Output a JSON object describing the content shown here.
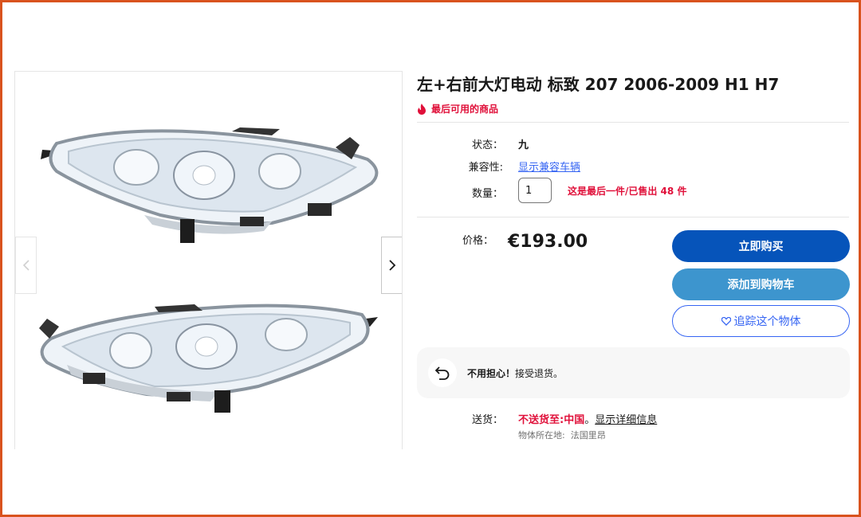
{
  "listing": {
    "title": "左+右前大灯电动 标致 207 2006-2009 H1 H7",
    "last_item_badge": "最后可用的商品"
  },
  "details": {
    "condition_label": "状态：",
    "condition_value": "九",
    "compat_label": "兼容性:",
    "compat_link": "显示兼容车辆",
    "quantity_label": "数量：",
    "quantity_value": "1",
    "quantity_note": "这是最后一件/已售出 48 件"
  },
  "pricing": {
    "price_label": "价格：",
    "price": "€193.00"
  },
  "actions": {
    "buy_now": "立即购买",
    "add_to_cart": "添加到购物车",
    "watch": "追踪这个物体"
  },
  "returns": {
    "headline": "不用担心！",
    "text": "接受退货。"
  },
  "shipping": {
    "label": "送货：",
    "no_ship": "不送货至:",
    "country": "中国",
    "period": "。",
    "details_link": "显示详细信息",
    "location_label": "物体所在地:",
    "location_value": "法国里昂"
  },
  "colors": {
    "frame": "#d9531e",
    "buy_button": "#0654ba",
    "cart_button": "#3d95ce",
    "link": "#3665f3",
    "alert_red": "#e0103a"
  },
  "icons": [
    "flame-icon",
    "chevron-left-icon",
    "chevron-right-icon",
    "heart-icon",
    "return-arrow-icon"
  ]
}
